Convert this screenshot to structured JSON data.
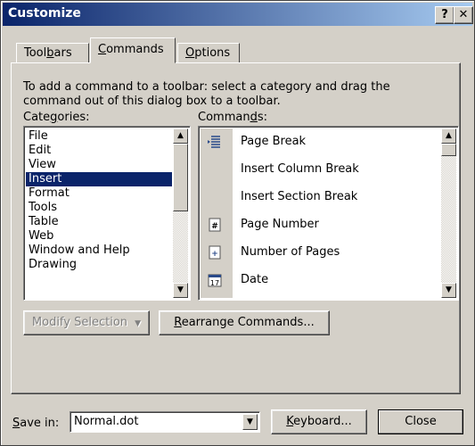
{
  "window": {
    "title": "Customize",
    "help_label": "?",
    "close_label": "✕"
  },
  "tabs": [
    {
      "label": "Toolbars"
    },
    {
      "label": "Commands"
    },
    {
      "label": "Options"
    }
  ],
  "description": "To add a command to a toolbar: select a category and drag the command out of this dialog box to a toolbar.",
  "categories_label": "Categories:",
  "commands_label": "Commands:",
  "categories": [
    "File",
    "Edit",
    "View",
    "Insert",
    "Format",
    "Tools",
    "Table",
    "Web",
    "Window and Help",
    "Drawing"
  ],
  "selected_category": "Insert",
  "commands": [
    {
      "label": "Page Break",
      "icon": "page-break-icon"
    },
    {
      "label": "Insert Column Break",
      "icon": ""
    },
    {
      "label": "Insert Section Break",
      "icon": ""
    },
    {
      "label": "Page Number",
      "icon": "page-number-icon"
    },
    {
      "label": "Number of Pages",
      "icon": "number-of-pages-icon"
    },
    {
      "label": "Date",
      "icon": "date-icon"
    }
  ],
  "buttons": {
    "modify_selection": "Modify Selection",
    "rearrange_commands": "Rearrange Commands...",
    "keyboard": "Keyboard...",
    "close": "Close"
  },
  "save_in": {
    "label": "Save in:",
    "value": "Normal.dot"
  },
  "colors": {
    "titlebar_start": "#0a246a",
    "titlebar_end": "#a6caf0",
    "dialog_face": "#d4d0c8",
    "selection": "#0a246a"
  }
}
